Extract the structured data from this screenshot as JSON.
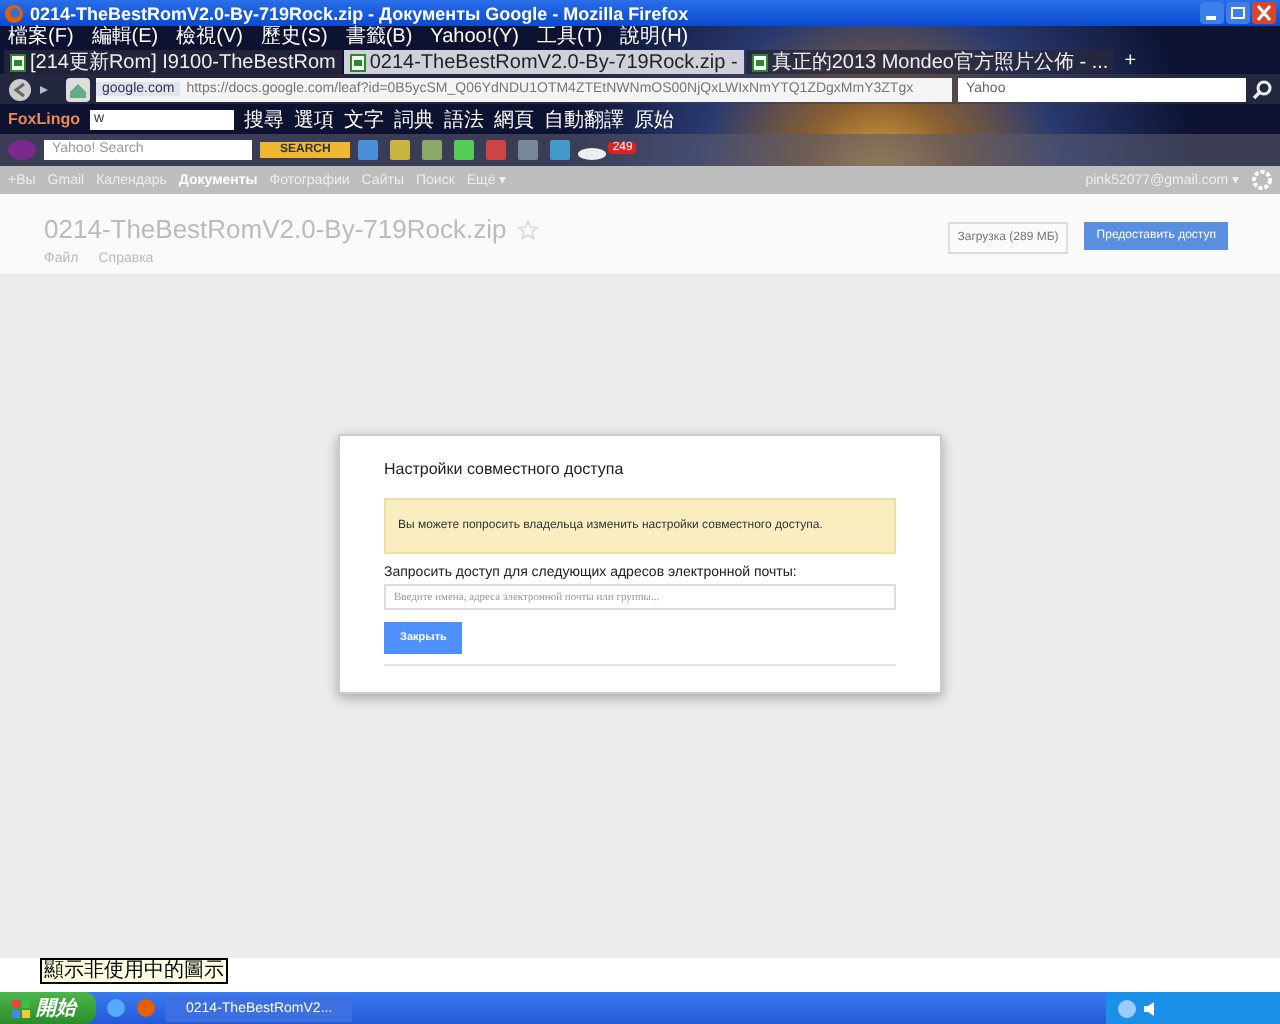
{
  "window": {
    "title": "0214-TheBestRomV2.0-By-719Rock.zip - Документы Google - Mozilla Firefox"
  },
  "menu": [
    "檔案(F)",
    "編輯(E)",
    "檢視(V)",
    "歷史(S)",
    "書籤(B)",
    "Yahoo!(Y)",
    "工具(T)",
    "說明(H)"
  ],
  "tabs": [
    {
      "label": "[214更新Rom] I9100-TheBestRom",
      "selected": false
    },
    {
      "label": "0214-TheBestRomV2.0-By-719Rock.zip -",
      "selected": true
    },
    {
      "label": "真正的2013 Mondeo官方照片公佈 - ...",
      "selected": false
    }
  ],
  "new_tab": "+",
  "nav": {
    "site": "google.com",
    "url": "https://docs.google.com/leaf?id=0B5ycSM_Q06YdNDU1OTM4ZTEtNWNmOS00NjQxLWIxNmYTQ1ZDgxMmY3ZTgx",
    "search": "Yahoo"
  },
  "foxlingo": {
    "logo": "FoxLingo",
    "input": "w",
    "buttons": [
      "搜尋",
      "選項",
      "文字",
      "詞典",
      "語法",
      "網頁",
      "自動翻譯",
      "原始"
    ]
  },
  "yahoo_toolbar": {
    "search_placeholder": "Yahoo! Search",
    "search_button": "SEARCH",
    "mail_badge": "249"
  },
  "google_bar": {
    "links": [
      {
        "label": "+Вы",
        "selected": false
      },
      {
        "label": "Gmail",
        "selected": false
      },
      {
        "label": "Календарь",
        "selected": false
      },
      {
        "label": "Документы",
        "selected": true
      },
      {
        "label": "Фотографии",
        "selected": false
      },
      {
        "label": "Сайты",
        "selected": false
      },
      {
        "label": "Поиск",
        "selected": false
      },
      {
        "label": "Ещё ▾",
        "selected": false
      }
    ],
    "account": "pink52077@gmail.com ▾"
  },
  "document": {
    "title": "0214-TheBestRomV2.0-By-719Rock.zip",
    "menu": [
      "Файл",
      "Справка"
    ],
    "download_button": "Загрузка (289 МБ)",
    "share_button": "Предоставить доступ"
  },
  "dialog": {
    "title": "Настройки совместного доступа",
    "notice": "Вы можете попросить владельца изменить настройки совместного доступа.",
    "field_label": "Запросить доступ для следующих адресов электронной почты:",
    "field_placeholder": "Введите имена, адреса электронной почты или группы...",
    "close_button": "Закрыть"
  },
  "taskbar": {
    "tooltip": "顯示非使用中的圖示",
    "start": "開始",
    "tasks": [
      {
        "label": "0214-TheBestRomV2...",
        "selected": false
      }
    ]
  }
}
